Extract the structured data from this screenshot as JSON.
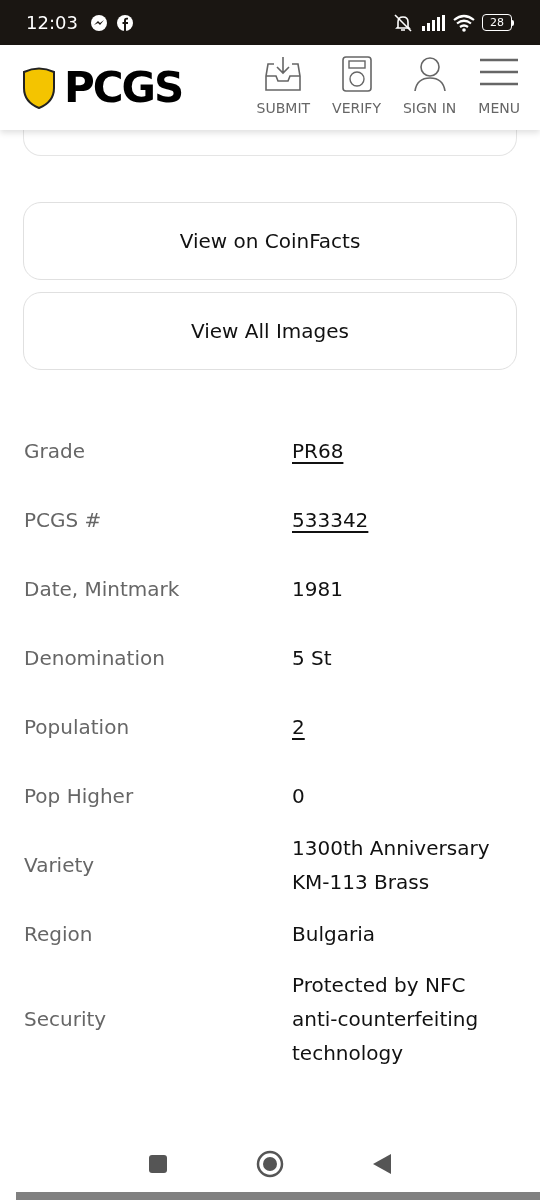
{
  "status_bar": {
    "time": "12:03",
    "battery": "28"
  },
  "header": {
    "logo": "PCGS",
    "nav": [
      {
        "kind": "submit",
        "label": "SUBMIT"
      },
      {
        "kind": "verify",
        "label": "VERIFY"
      },
      {
        "kind": "signin",
        "label": "SIGN IN"
      },
      {
        "kind": "menu",
        "label": "MENU"
      }
    ]
  },
  "buttons": [
    "View on CoinFacts",
    "View All Images"
  ],
  "details": [
    {
      "label": "Grade",
      "value": "PR68",
      "link": true
    },
    {
      "label": "PCGS #",
      "value": "533342",
      "link": true
    },
    {
      "label": "Date, Mintmark",
      "value": "1981",
      "link": false
    },
    {
      "label": "Denomination",
      "value": "5 St",
      "link": false
    },
    {
      "label": "Population",
      "value": "2",
      "link": true
    },
    {
      "label": "Pop Higher",
      "value": "0",
      "link": false
    },
    {
      "label": "Variety",
      "value": "1300th Anniversary KM-113 Brass",
      "link": false
    },
    {
      "label": "Region",
      "value": "Bulgaria",
      "link": false
    },
    {
      "label": "Security",
      "value": "Protected by NFC anti-counterfeiting technology",
      "link": false
    }
  ]
}
